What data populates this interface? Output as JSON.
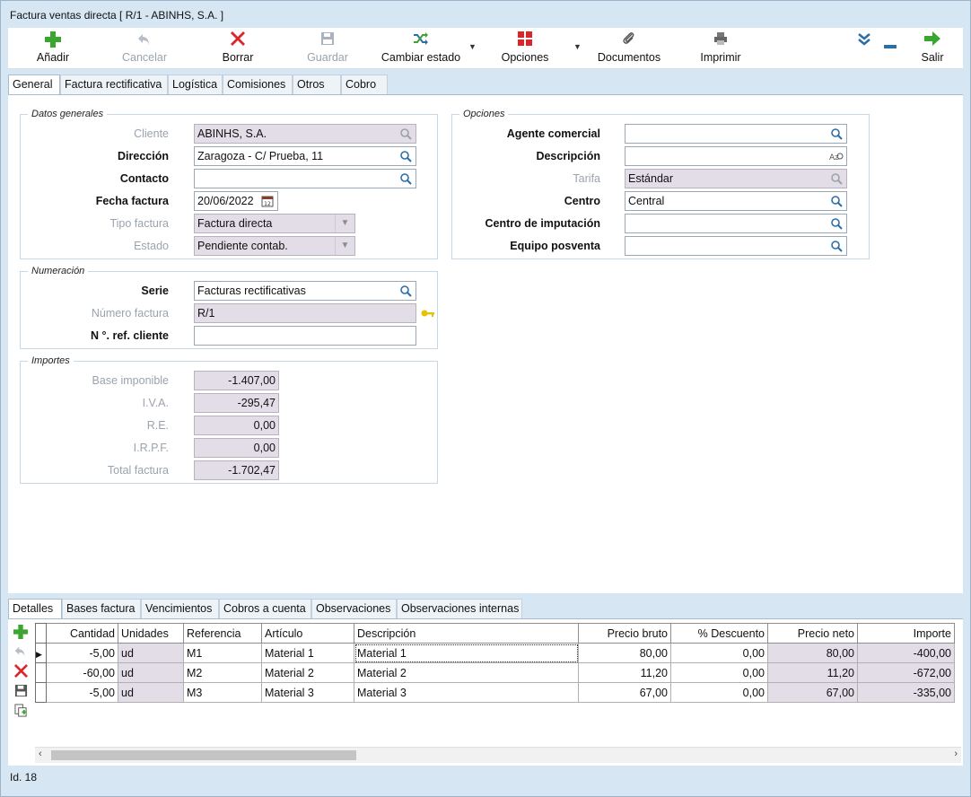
{
  "window": {
    "title": "Factura ventas directa  [ R/1  -  ABINHS, S.A. ]"
  },
  "toolbar": {
    "add": "Añadir",
    "cancel": "Cancelar",
    "delete": "Borrar",
    "save": "Guardar",
    "change_state": "Cambiar estado",
    "options": "Opciones",
    "documents": "Documentos",
    "print": "Imprimir",
    "exit": "Salir"
  },
  "tabs": [
    "General",
    "Factura rectificativa",
    "Logística",
    "Comisiones",
    "Otros",
    "Cobro"
  ],
  "datos_generales": {
    "legend": "Datos generales",
    "cliente_label": "Cliente",
    "cliente": "ABINHS, S.A.",
    "direccion_label": "Dirección",
    "direccion": "Zaragoza  -  C/ Prueba, 11",
    "contacto_label": "Contacto",
    "contacto": "",
    "fecha_label": "Fecha factura",
    "fecha": "20/06/2022",
    "tipo_label": "Tipo factura",
    "tipo": "Factura directa",
    "estado_label": "Estado",
    "estado": "Pendiente contab."
  },
  "numeracion": {
    "legend": "Numeración",
    "serie_label": "Serie",
    "serie": "Facturas rectificativas",
    "numero_label": "Número factura",
    "numero": "R/1",
    "ref_label": "N °. ref. cliente",
    "ref": ""
  },
  "importes": {
    "legend": "Importes",
    "base_label": "Base imponible",
    "base": "-1.407,00",
    "iva_label": "I.V.A.",
    "iva": "-295,47",
    "re_label": "R.E.",
    "re": "0,00",
    "irpf_label": "I.R.P.F.",
    "irpf": "0,00",
    "total_label": "Total factura",
    "total": "-1.702,47"
  },
  "opciones": {
    "legend": "Opciones",
    "agente_label": "Agente comercial",
    "agente": "",
    "descripcion_label": "Descripción",
    "descripcion": "",
    "tarifa_label": "Tarifa",
    "tarifa": "Estándar",
    "centro_label": "Centro",
    "centro": "Central",
    "imputacion_label": "Centro de imputación",
    "imputacion": "",
    "equipo_label": "Equipo posventa",
    "equipo": ""
  },
  "bottom_tabs": [
    "Detalles",
    "Bases factura",
    "Vencimientos",
    "Cobros a cuenta",
    "Observaciones",
    "Observaciones internas"
  ],
  "grid": {
    "columns": [
      "Cantidad",
      "Unidades",
      "Referencia",
      "Artículo",
      "Descripción",
      "Precio bruto",
      "% Descuento",
      "Precio neto",
      "Importe"
    ],
    "rows": [
      [
        "-5,00",
        "ud",
        "M1",
        "Material 1",
        "Material 1",
        "80,00",
        "0,00",
        "80,00",
        "-400,00"
      ],
      [
        "-60,00",
        "ud",
        "M2",
        "Material 2",
        "Material 2",
        "11,20",
        "0,00",
        "11,20",
        "-672,00"
      ],
      [
        "-5,00",
        "ud",
        "M3",
        "Material 3",
        "Material 3",
        "67,00",
        "0,00",
        "67,00",
        "-335,00"
      ]
    ]
  },
  "status": {
    "id": "Id. 18"
  },
  "colors": {
    "accent_green": "#3aa52f",
    "delete_red": "#d9262a",
    "readonly_bg": "#e3dde8",
    "search_blue": "#2d6ea8"
  }
}
